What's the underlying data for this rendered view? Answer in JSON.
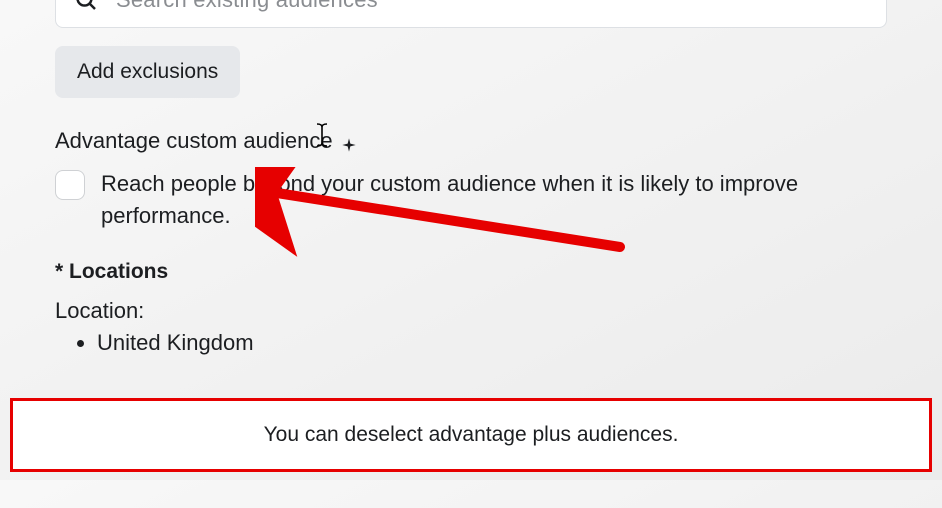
{
  "search": {
    "placeholder": "Search existing audiences"
  },
  "buttons": {
    "add_exclusions": "Add exclusions"
  },
  "advantage": {
    "title": "Advantage custom audience",
    "description": "Reach people beyond your custom audience when it is likely to improve performance."
  },
  "locations": {
    "header": "* Locations",
    "label": "Location:",
    "items": [
      "United Kingdom"
    ]
  },
  "callout": {
    "text": "You can deselect advantage plus audiences."
  }
}
